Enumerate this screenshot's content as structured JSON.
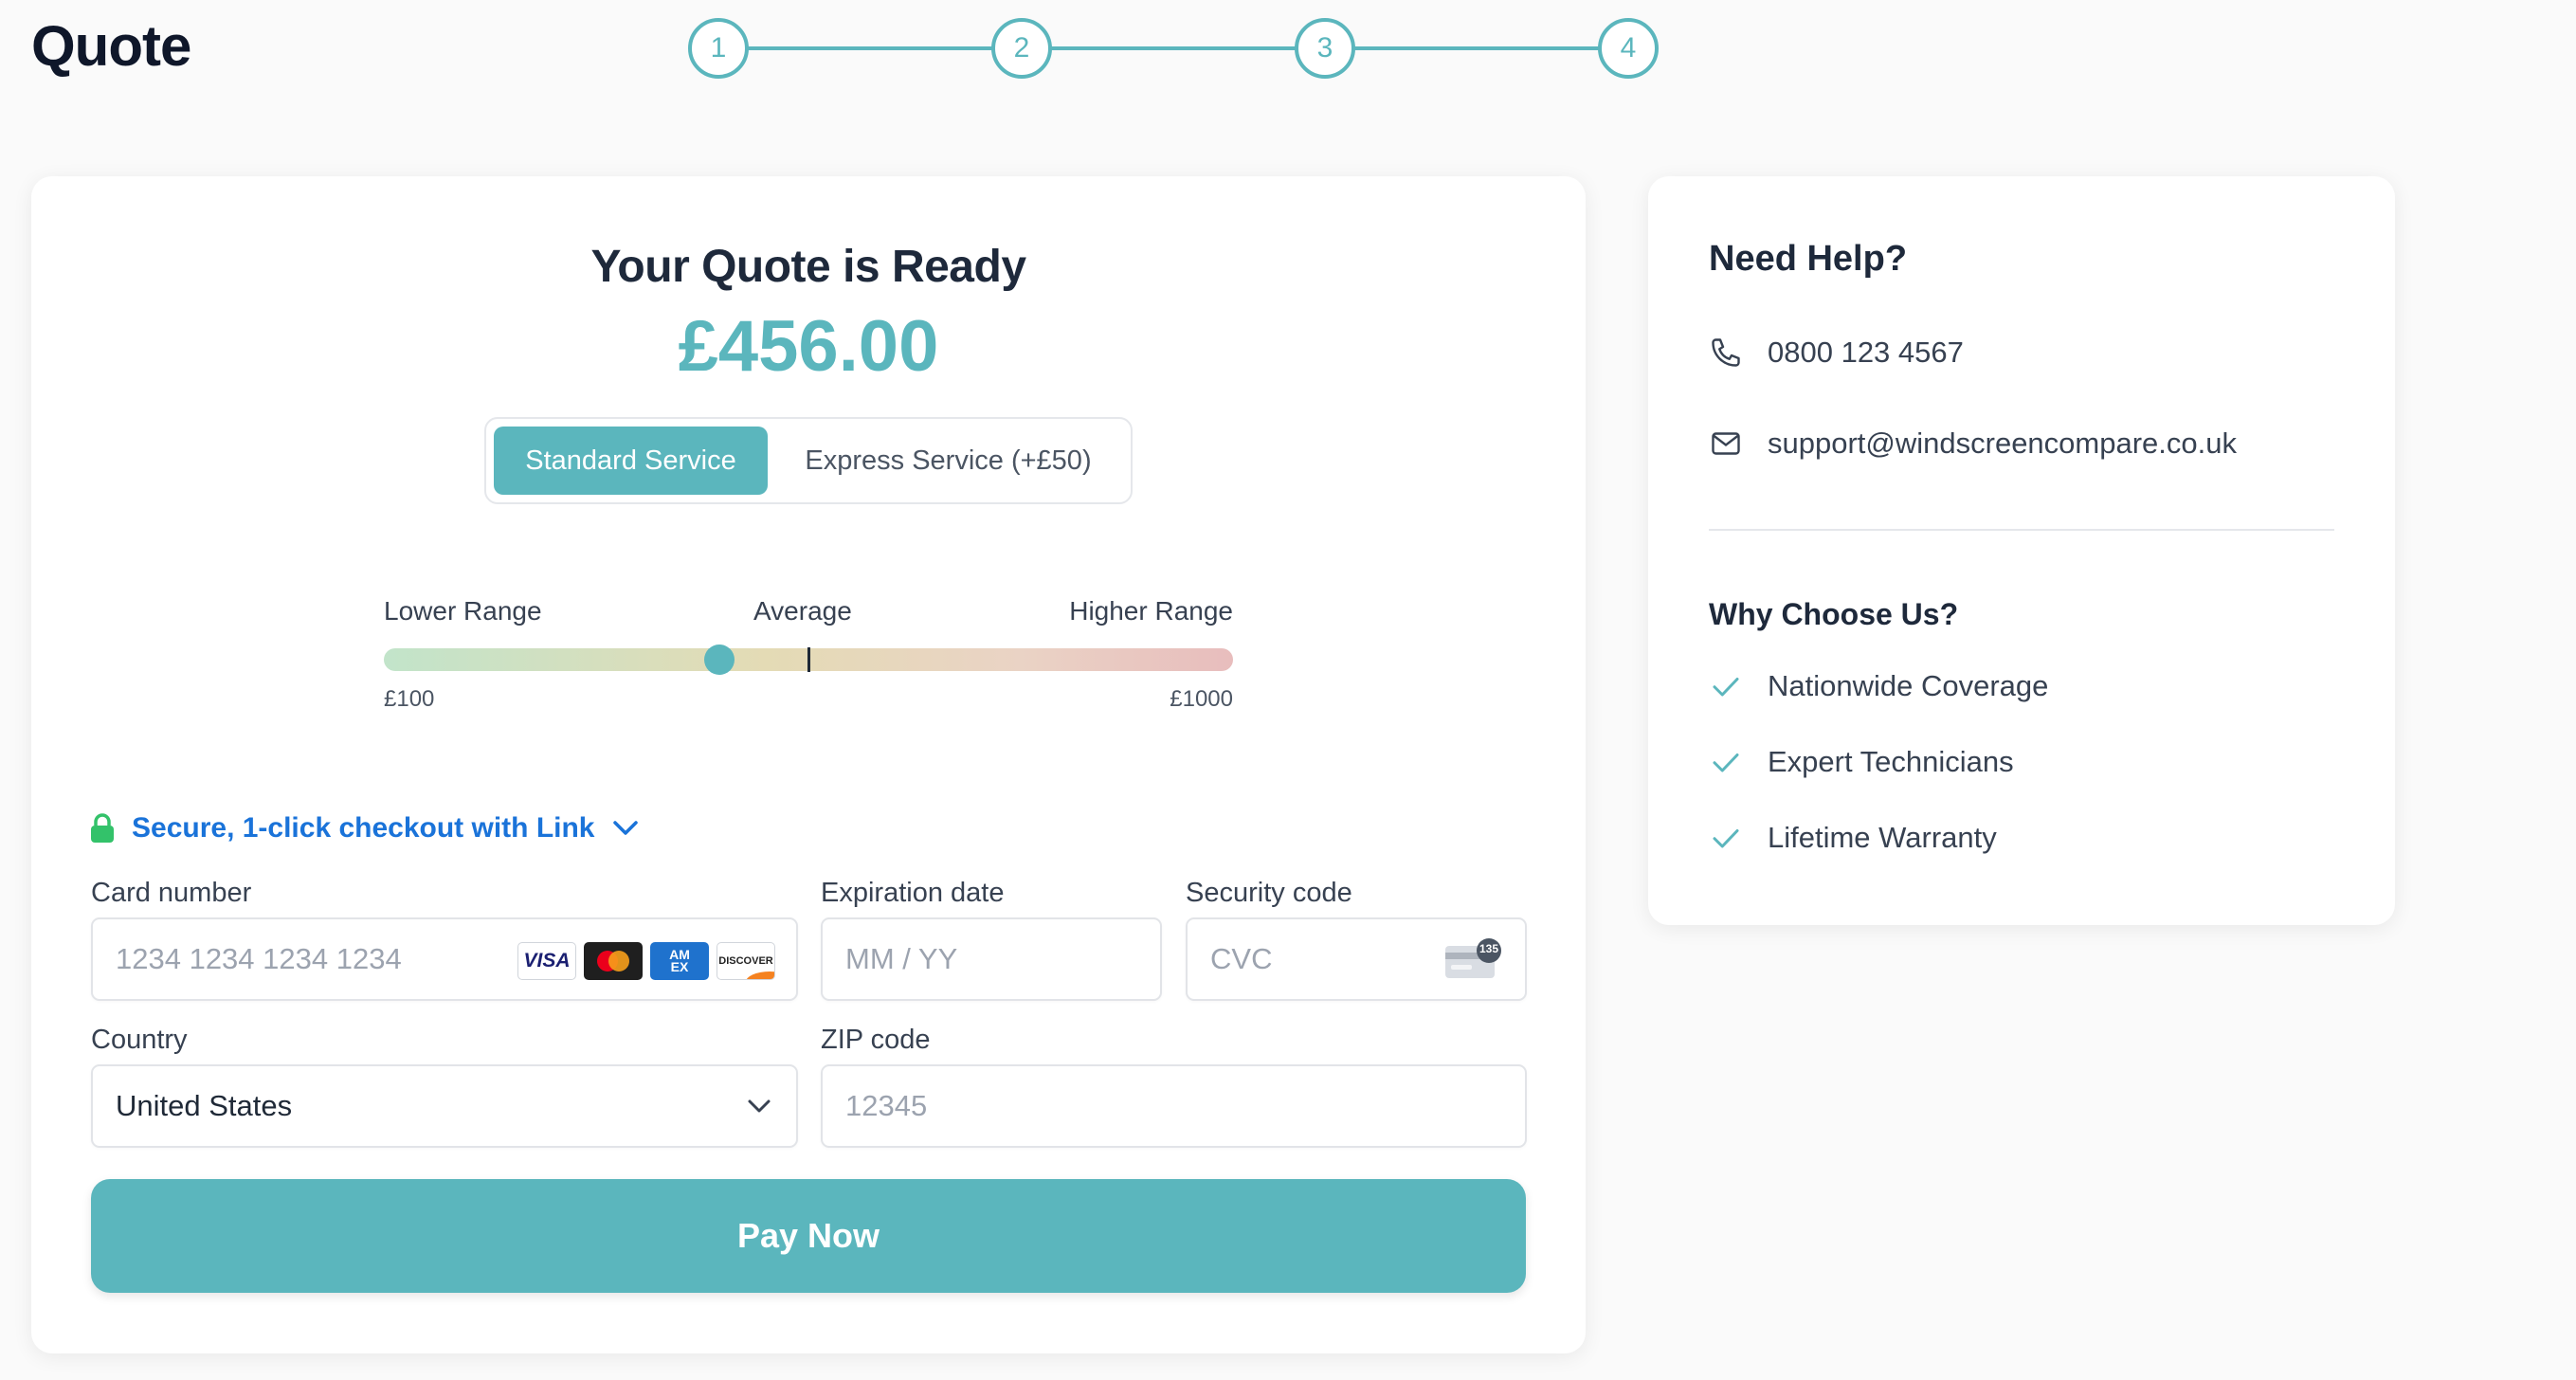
{
  "header": {
    "title": "Quote"
  },
  "stepper": {
    "steps": [
      "1",
      "2",
      "3",
      "4"
    ]
  },
  "quote": {
    "heading": "Your Quote is Ready",
    "price": "£456.00",
    "services": {
      "standard": "Standard Service",
      "express": "Express Service (+£50)",
      "selected": "standard"
    }
  },
  "range": {
    "lower_label": "Lower Range",
    "average_label": "Average",
    "higher_label": "Higher Range",
    "min_label": "£100",
    "max_label": "£1000",
    "quote_fraction": 0.395,
    "average_fraction": 0.5
  },
  "payment": {
    "link_text": "Secure, 1-click checkout with Link",
    "card_number_label": "Card number",
    "card_number_placeholder": "1234 1234 1234 1234",
    "expiry_label": "Expiration date",
    "expiry_placeholder": "MM / YY",
    "security_label": "Security code",
    "security_placeholder": "CVC",
    "cvc_badge": "135",
    "country_label": "Country",
    "country_value": "United States",
    "zip_label": "ZIP code",
    "zip_placeholder": "12345",
    "card_brands": {
      "visa": "VISA",
      "amex_top": "AM",
      "amex_bottom": "EX",
      "discover": "DISCOVER"
    },
    "pay_label": "Pay Now"
  },
  "help": {
    "title": "Need Help?",
    "phone": "0800 123 4567",
    "email": "support@windscreencompare.co.uk",
    "why_title": "Why Choose Us?",
    "reasons": [
      "Nationwide Coverage",
      "Expert Technicians",
      "Lifetime Warranty"
    ]
  },
  "colors": {
    "accent": "#5bb6bd",
    "link": "#1a73d9",
    "lock": "#33c26a"
  }
}
